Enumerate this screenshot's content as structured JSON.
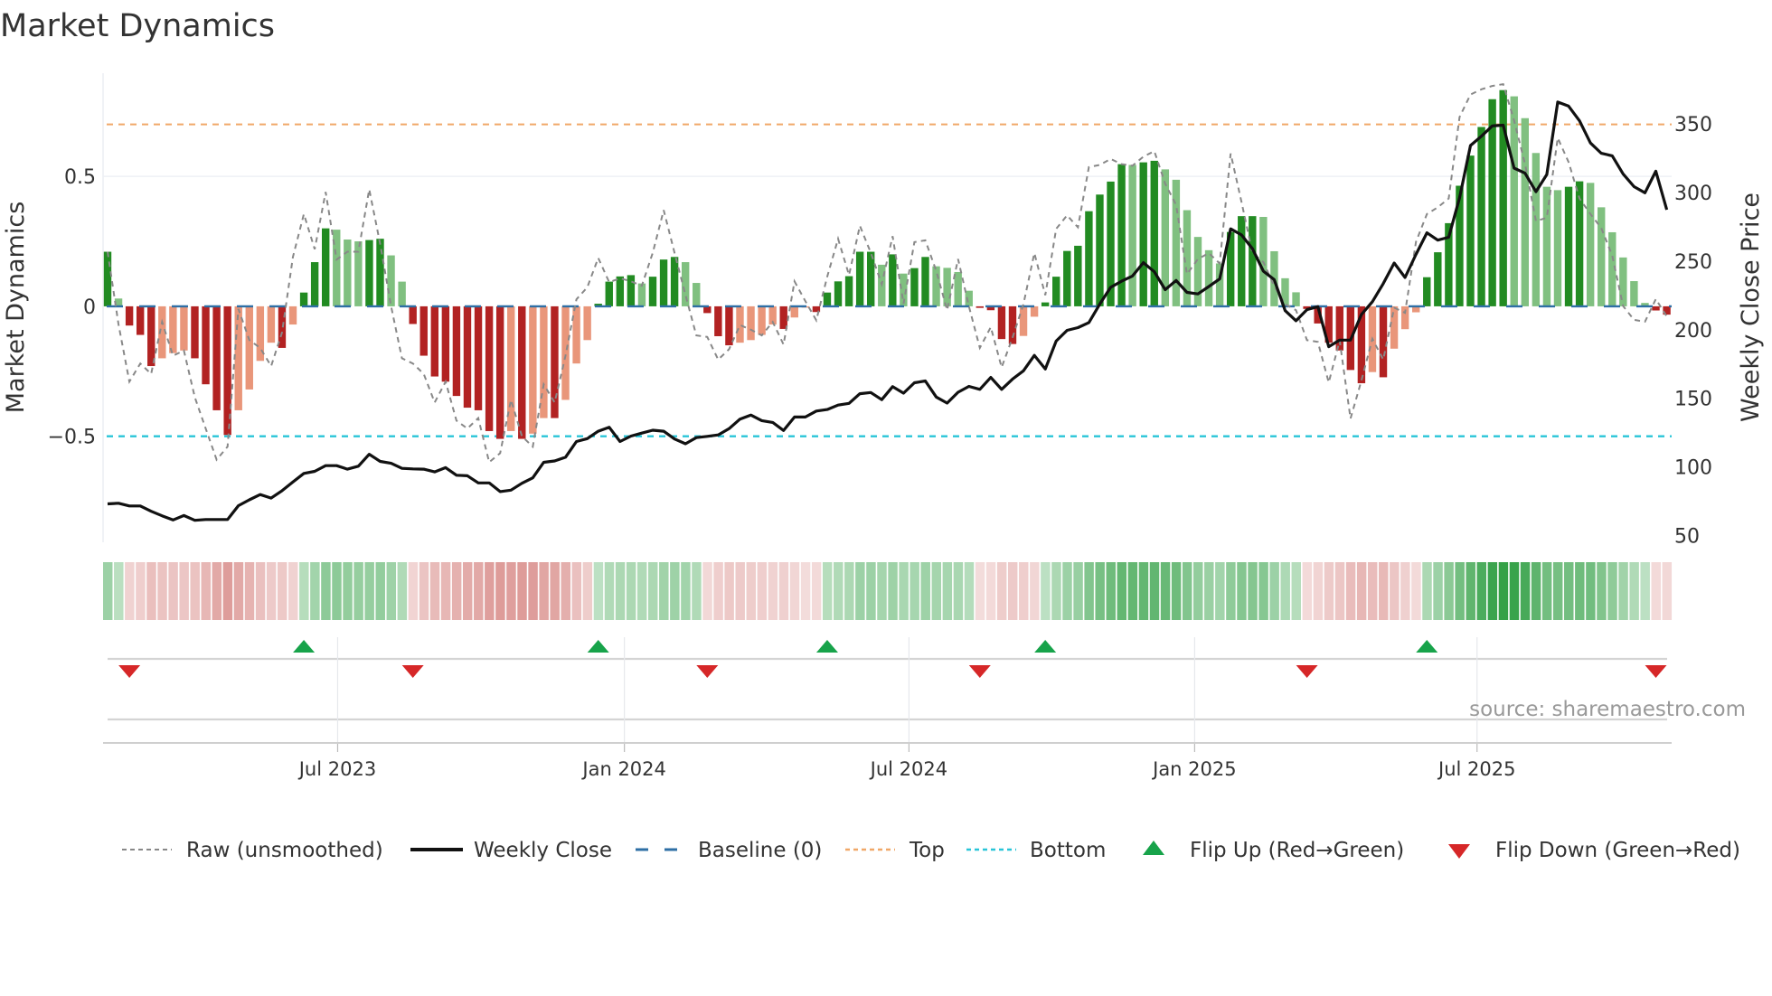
{
  "chart_data": {
    "type": "bar",
    "title": "Market Dynamics",
    "ylabel": "Market Dynamics",
    "y2label": "Weekly Close Price",
    "ylim": [
      -0.908,
      0.897
    ],
    "y2lim": [
      45,
      387
    ],
    "yticks": [
      {
        "v": 0.5,
        "label": "0.5"
      },
      {
        "v": 0,
        "label": "0"
      },
      {
        "v": -0.5,
        "label": "−0.5"
      }
    ],
    "y2ticks": [
      50,
      100,
      150,
      200,
      250,
      300,
      350
    ],
    "x_unit": "week index",
    "xticks": [
      {
        "pos": 21.1,
        "label": "Jul 2023"
      },
      {
        "pos": 47.4,
        "label": "Jan 2024"
      },
      {
        "pos": 73.5,
        "label": "Jul 2024"
      },
      {
        "pos": 99.7,
        "label": "Jan 2025"
      },
      {
        "pos": 125.6,
        "label": "Jul 2025"
      }
    ],
    "levels": {
      "baseline": 0,
      "top": 0.7,
      "bottom": -0.5
    },
    "colors": {
      "up_strong": "#228b22",
      "up_weak": "#80c080",
      "down_strong": "#b22222",
      "down_weak": "#e9967a",
      "baseline": "#2e6fa5",
      "top": "#f0a868",
      "bottom": "#29c5d8",
      "raw": "#888888",
      "close": "#111111",
      "flip_up": "#17a34a",
      "flip_down": "#d62728"
    },
    "strength": "DLDDDLLLDDDDLLLLDLDDDLLLDDLLDDDDDDDDDLDLLDLLLDDDDLDDDLLDDDLLLLDLLDDDDDDLDLDDLLLLDDDDLLDDDDDDDDLDDLLLLLLDDDLLLLDDDDDDLDLLLDDDDDDDDLLLLLDDLLLLLLDD",
    "dynamics": [
      0.21,
      0.03,
      -0.074,
      -0.11,
      -0.23,
      -0.2,
      -0.18,
      -0.17,
      -0.2,
      -0.3,
      -0.4,
      -0.495,
      -0.4,
      -0.32,
      -0.21,
      -0.14,
      -0.16,
      -0.07,
      0.053,
      0.17,
      0.3,
      0.295,
      0.257,
      0.25,
      0.255,
      0.26,
      0.196,
      0.095,
      -0.068,
      -0.19,
      -0.27,
      -0.29,
      -0.345,
      -0.39,
      -0.4,
      -0.48,
      -0.51,
      -0.48,
      -0.51,
      -0.49,
      -0.43,
      -0.43,
      -0.36,
      -0.22,
      -0.13,
      0.01,
      0.095,
      0.115,
      0.12,
      0.088,
      0.114,
      0.18,
      0.19,
      0.17,
      0.09,
      -0.026,
      -0.115,
      -0.15,
      -0.14,
      -0.13,
      -0.11,
      -0.07,
      -0.087,
      -0.043,
      -0.005,
      -0.022,
      0.053,
      0.096,
      0.116,
      0.21,
      0.21,
      0.16,
      0.2,
      0.126,
      0.147,
      0.19,
      0.154,
      0.148,
      0.132,
      0.06,
      -0.006,
      -0.015,
      -0.126,
      -0.145,
      -0.114,
      -0.04,
      0.015,
      0.114,
      0.213,
      0.233,
      0.366,
      0.43,
      0.48,
      0.547,
      0.544,
      0.554,
      0.56,
      0.527,
      0.487,
      0.37,
      0.267,
      0.216,
      0.165,
      0.286,
      0.347,
      0.347,
      0.344,
      0.212,
      0.108,
      0.054,
      -0.01,
      -0.066,
      -0.14,
      -0.17,
      -0.245,
      -0.296,
      -0.253,
      -0.273,
      -0.163,
      -0.088,
      -0.023,
      0.112,
      0.208,
      0.32,
      0.464,
      0.58,
      0.69,
      0.797,
      0.832,
      0.808,
      0.724,
      0.59,
      0.46,
      0.447,
      0.46,
      0.481,
      0.475,
      0.381,
      0.285,
      0.188,
      0.097,
      0.013,
      -0.016,
      -0.032
    ],
    "raw": [
      0.21,
      -0.07,
      -0.29,
      -0.22,
      -0.26,
      -0.06,
      -0.19,
      -0.17,
      -0.35,
      -0.47,
      -0.59,
      -0.54,
      -0.01,
      -0.13,
      -0.16,
      -0.23,
      -0.1,
      0.19,
      0.355,
      0.22,
      0.44,
      0.18,
      0.21,
      0.21,
      0.45,
      0.24,
      0,
      -0.2,
      -0.22,
      -0.26,
      -0.37,
      -0.29,
      -0.44,
      -0.47,
      -0.43,
      -0.6,
      -0.565,
      -0.36,
      -0.5,
      -0.54,
      -0.3,
      -0.37,
      -0.19,
      0.027,
      0.073,
      0.186,
      0.093,
      0.108,
      0.096,
      0.079,
      0.206,
      0.37,
      0.206,
      0.044,
      -0.112,
      -0.118,
      -0.205,
      -0.165,
      -0.072,
      -0.09,
      -0.112,
      -0.06,
      -0.147,
      0.096,
      0.02,
      -0.054,
      0.114,
      0.26,
      0.12,
      0.31,
      0.206,
      0.085,
      0.27,
      0.01,
      0.247,
      0.254,
      0.136,
      -0.015,
      0.182,
      0,
      -0.16,
      -0.08,
      -0.235,
      -0.12,
      0.008,
      0.205,
      0.043,
      0.298,
      0.35,
      0.304,
      0.536,
      0.544,
      0.567,
      0.547,
      0.541,
      0.576,
      0.597,
      0.472,
      0.39,
      0.124,
      0.182,
      0.205,
      0.165,
      0.588,
      0.402,
      0.205,
      0.17,
      0.078,
      0.008,
      -0.015,
      -0.13,
      -0.137,
      -0.293,
      -0.132,
      -0.432,
      -0.285,
      -0.125,
      -0.205,
      -0.005,
      -0.025,
      0.248,
      0.355,
      0.381,
      0.415,
      0.728,
      0.815,
      0.835,
      0.848,
      0.855,
      0.715,
      0.548,
      0.328,
      0.341,
      0.648,
      0.555,
      0.415,
      0.355,
      0.301,
      0.195,
      0.001,
      -0.052,
      -0.059,
      0.028,
      -0.039
    ],
    "close": [
      73,
      73.5,
      71.5,
      71.5,
      67.6,
      64.3,
      61.3,
      64.5,
      61,
      61.6,
      61.6,
      61.6,
      71.7,
      76,
      79.8,
      77.2,
      82.6,
      89,
      95.2,
      96.7,
      100.9,
      100.9,
      98.3,
      100.5,
      109.2,
      104,
      102.6,
      98.9,
      98.5,
      98.3,
      96.3,
      99.4,
      93.9,
      93.5,
      88.3,
      88.3,
      82,
      83,
      88,
      92,
      103.3,
      104.3,
      107,
      118.5,
      120.6,
      126,
      128.9,
      118.5,
      122.4,
      124.6,
      126.7,
      126,
      120.3,
      116.8,
      121.3,
      122.2,
      123.3,
      127.8,
      134.8,
      137.8,
      133.7,
      132.4,
      126.5,
      136.3,
      136.3,
      140.7,
      141.8,
      145,
      146.3,
      153.3,
      154.2,
      149,
      158.5,
      153.7,
      161.3,
      162.6,
      150.9,
      146.5,
      154.4,
      158.7,
      156.5,
      165.2,
      156.5,
      164,
      170,
      181.3,
      171.3,
      191.7,
      199.5,
      201.5,
      205.2,
      218.7,
      230.9,
      235.4,
      239.1,
      248.9,
      242.2,
      229.2,
      235.9,
      227.2,
      226.1,
      231.5,
      237,
      273.5,
      269.1,
      259.1,
      242.7,
      236.5,
      213.9,
      206.5,
      214.6,
      216.8,
      187.6,
      192.4,
      192.4,
      211.1,
      220.4,
      233.6,
      248.6,
      238.1,
      254.9,
      270.6,
      265.3,
      267.4,
      296.1,
      334.3,
      341.1,
      348.6,
      349.1,
      317.8,
      314.1,
      300.6,
      313.1,
      366,
      363,
      352.3,
      336.1,
      328.6,
      326.8,
      313.6,
      304.3,
      299.8,
      315.6,
      287.4
    ],
    "flip_up": [
      18,
      45,
      66,
      86,
      121
    ],
    "flip_down": [
      2,
      28,
      55,
      80,
      110,
      142
    ],
    "legend": {
      "placement": "bottom",
      "items": [
        {
          "key": "raw",
          "label": "Raw (unsmoothed)"
        },
        {
          "key": "close",
          "label": "Weekly Close"
        },
        {
          "key": "baseline",
          "label": "Baseline (0)"
        },
        {
          "key": "top",
          "label": "Top"
        },
        {
          "key": "bottom",
          "label": "Bottom"
        },
        {
          "key": "flip_up",
          "label": "Flip Up (Red→Green)"
        },
        {
          "key": "flip_down",
          "label": "Flip Down (Green→Red)"
        }
      ]
    },
    "source": "source: sharemaestro.com"
  }
}
